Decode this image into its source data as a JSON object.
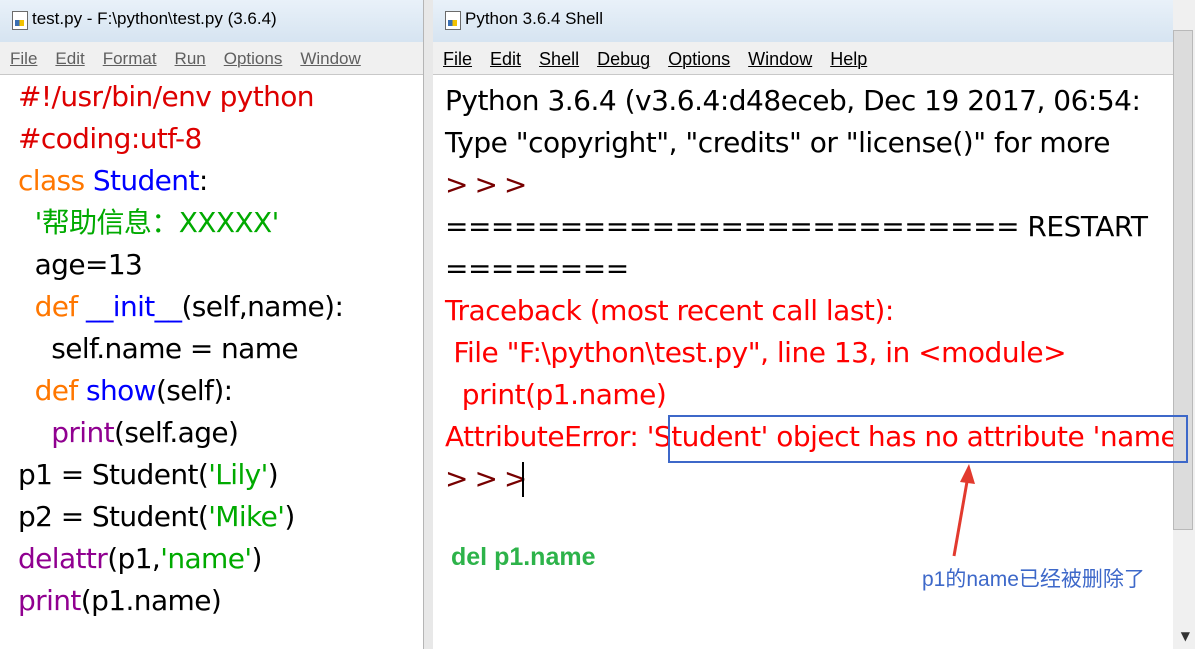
{
  "editor": {
    "title": "test.py - F:\\python\\test.py (3.6.4)",
    "menu": [
      "File",
      "Edit",
      "Format",
      "Run",
      "Options",
      "Window"
    ],
    "code": [
      [
        {
          "c": "cm",
          "t": "#!/usr/bin/env python"
        }
      ],
      [
        {
          "c": "cm",
          "t": "#coding:utf-8"
        }
      ],
      [
        {
          "c": "kw",
          "t": "class "
        },
        {
          "c": "df",
          "t": "Student"
        },
        {
          "c": "nm",
          "t": ":"
        }
      ],
      [
        {
          "c": "nm",
          "t": "  "
        },
        {
          "c": "st",
          "t": "'帮助信息：XXXXX'"
        }
      ],
      [
        {
          "c": "nm",
          "t": "  age=13"
        }
      ],
      [
        {
          "c": "nm",
          "t": "  "
        },
        {
          "c": "kw",
          "t": "def "
        },
        {
          "c": "df",
          "t": "__init__"
        },
        {
          "c": "nm",
          "t": "(self,name):"
        }
      ],
      [
        {
          "c": "nm",
          "t": "    self.name = name"
        }
      ],
      [
        {
          "c": "nm",
          "t": "  "
        },
        {
          "c": "kw",
          "t": "def "
        },
        {
          "c": "df",
          "t": "show"
        },
        {
          "c": "nm",
          "t": "(self):"
        }
      ],
      [
        {
          "c": "nm",
          "t": "    "
        },
        {
          "c": "bi",
          "t": "print"
        },
        {
          "c": "nm",
          "t": "(self.age)"
        }
      ],
      [
        {
          "c": "nm",
          "t": "p1 = Student("
        },
        {
          "c": "st",
          "t": "'Lily'"
        },
        {
          "c": "nm",
          "t": ")"
        }
      ],
      [
        {
          "c": "nm",
          "t": "p2 = Student("
        },
        {
          "c": "st",
          "t": "'Mike'"
        },
        {
          "c": "nm",
          "t": ")"
        }
      ],
      [
        {
          "c": "bi",
          "t": "delattr"
        },
        {
          "c": "nm",
          "t": "(p1,"
        },
        {
          "c": "st",
          "t": "'name'"
        },
        {
          "c": "nm",
          "t": ")"
        }
      ],
      [
        {
          "c": "bi",
          "t": "print"
        },
        {
          "c": "nm",
          "t": "(p1.name)"
        }
      ]
    ]
  },
  "shell": {
    "title": "Python 3.6.4 Shell",
    "menu": [
      "File",
      "Edit",
      "Shell",
      "Debug",
      "Options",
      "Window",
      "Help"
    ],
    "lines": [
      [
        {
          "c": "nm",
          "t": "Python 3.6.4 (v3.6.4:d48eceb, Dec 19 2017, 06:54:"
        }
      ],
      [
        {
          "c": "nm",
          "t": "Type \"copyright\", \"credits\" or \"license()\" for more"
        }
      ],
      [
        {
          "c": "prompt",
          "t": ">>>"
        }
      ],
      [
        {
          "c": "nm",
          "t": "========================= RESTART"
        }
      ],
      [
        {
          "c": "nm",
          "t": "========"
        }
      ],
      [
        {
          "c": "err",
          "t": "Traceback (most recent call last):"
        }
      ],
      [
        {
          "c": "err",
          "t": " File \"F:\\python\\test.py\", line 13, in <module>"
        }
      ],
      [
        {
          "c": "err",
          "t": "  print(p1.name)"
        }
      ],
      [
        {
          "c": "err",
          "t": "AttributeError: 'Student' object has no attribute 'name'"
        }
      ],
      [
        {
          "c": "prompt",
          "t": ">>>"
        }
      ]
    ]
  },
  "annotations": {
    "green_note": "del p1.name",
    "blue_note": "p1的name已经被删除了",
    "colors": {
      "green": "#2db34a",
      "blue": "#3d68c9"
    }
  },
  "colors": {
    "keyword": "#ff7700",
    "comment": "#dd0000",
    "definition": "#0000ff",
    "string": "#00aa00",
    "builtin": "#900090",
    "error": "#ff0000"
  }
}
